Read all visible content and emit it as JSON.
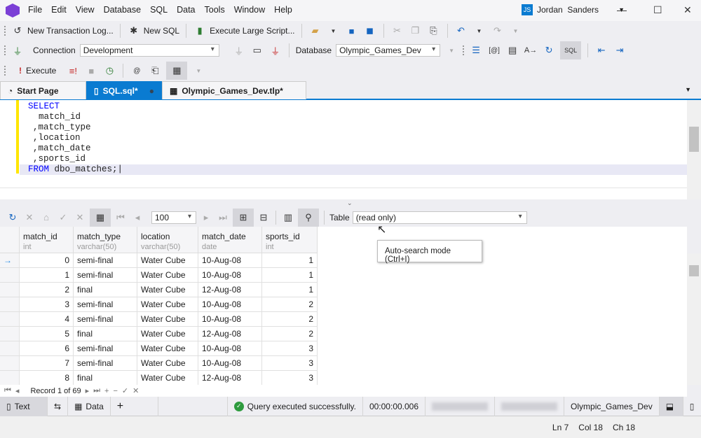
{
  "app": {
    "user_initials": "JS",
    "user_name": "Jordan  Sanders"
  },
  "menu": [
    "File",
    "Edit",
    "View",
    "Database",
    "SQL",
    "Data",
    "Tools",
    "Window",
    "Help"
  ],
  "toolbar1": {
    "new_transaction_log": "New Transaction Log...",
    "new_sql": "New SQL",
    "execute_large_script": "Execute Large Script..."
  },
  "toolbar2": {
    "connection_label": "Connection",
    "connection_value": "Development",
    "database_label": "Database",
    "database_value": "Olympic_Games_Dev"
  },
  "toolbar3": {
    "execute": "Execute"
  },
  "tabs": [
    {
      "label": "Start Page"
    },
    {
      "label": "SQL.sql*",
      "active": true
    },
    {
      "label": "Olympic_Games_Dev.tlp*"
    }
  ],
  "editor": {
    "lines": [
      "SELECT",
      "  match_id",
      ",match_type",
      ",location",
      ",match_date",
      ",sports_id",
      "FROM dbo_matches;"
    ]
  },
  "grid_toolbar": {
    "page_size": "100",
    "table_label": "Table",
    "table_value": "(read only)"
  },
  "tooltip": "Auto-search mode (Ctrl+I)",
  "grid": {
    "columns": [
      {
        "name": "match_id",
        "type": "int"
      },
      {
        "name": "match_type",
        "type": "varchar(50)"
      },
      {
        "name": "location",
        "type": "varchar(50)"
      },
      {
        "name": "match_date",
        "type": "date"
      },
      {
        "name": "sports_id",
        "type": "int"
      }
    ],
    "rows": [
      [
        "0",
        "semi-final",
        "Water Cube",
        "10-Aug-08",
        "1"
      ],
      [
        "1",
        "semi-final",
        "Water Cube",
        "10-Aug-08",
        "1"
      ],
      [
        "2",
        "final",
        "Water Cube",
        "12-Aug-08",
        "1"
      ],
      [
        "3",
        "semi-final",
        "Water Cube",
        "10-Aug-08",
        "2"
      ],
      [
        "4",
        "semi-final",
        "Water Cube",
        "10-Aug-08",
        "2"
      ],
      [
        "5",
        "final",
        "Water Cube",
        "12-Aug-08",
        "2"
      ],
      [
        "6",
        "semi-final",
        "Water Cube",
        "10-Aug-08",
        "3"
      ],
      [
        "7",
        "semi-final",
        "Water Cube",
        "10-Aug-08",
        "3"
      ],
      [
        "8",
        "final",
        "Water Cube",
        "12-Aug-08",
        "3"
      ]
    ]
  },
  "nav": {
    "record": "Record 1 of 69"
  },
  "status": {
    "text_tab": "Text",
    "data_tab": "Data",
    "message": "Query executed successfully.",
    "elapsed": "00:00:00.006",
    "database": "Olympic_Games_Dev"
  },
  "cursor": {
    "ln": "Ln 7",
    "col": "Col 18",
    "ch": "Ch 18"
  }
}
